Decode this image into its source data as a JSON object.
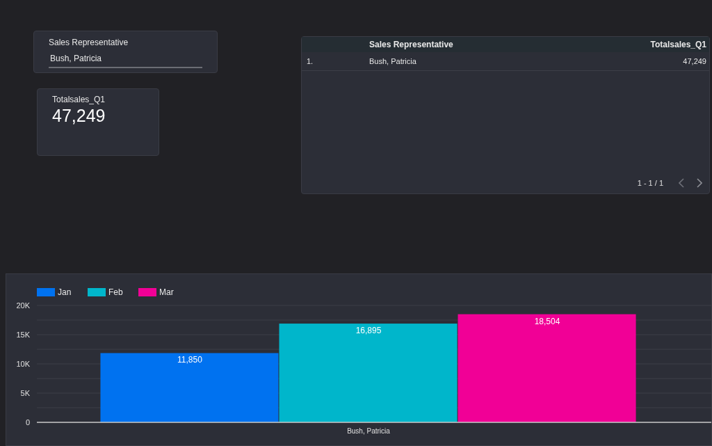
{
  "filter": {
    "label": "Sales Representative",
    "value": "Bush, Patricia"
  },
  "scorecard": {
    "label": "Totalsales_Q1",
    "value": "47,249"
  },
  "table": {
    "columns": [
      "Sales Representative",
      "Totalsales_Q1"
    ],
    "rows": [
      {
        "index": "1.",
        "cells": [
          "Bush, Patricia",
          "47,249"
        ]
      }
    ],
    "pagination": "1 - 1 / 1"
  },
  "chart": {
    "chart_data": {
      "type": "bar",
      "categories": [
        "Bush, Patricia"
      ],
      "series": [
        {
          "name": "Jan",
          "color": "#0072f0",
          "values": [
            11850
          ]
        },
        {
          "name": "Feb",
          "color": "#00b6cb",
          "values": [
            16895
          ]
        },
        {
          "name": "Mar",
          "color": "#f10096",
          "values": [
            18504
          ]
        }
      ],
      "ylim": [
        0,
        20000
      ],
      "grid": true,
      "legend": true,
      "yticks": [
        {
          "value": 0,
          "label": "0"
        },
        {
          "value": 5000,
          "label": "5K"
        },
        {
          "value": 10000,
          "label": "10K"
        },
        {
          "value": 15000,
          "label": "15K"
        },
        {
          "value": 20000,
          "label": "20K"
        }
      ],
      "value_labels": [
        "11,850",
        "16,895",
        "18,504"
      ]
    }
  }
}
